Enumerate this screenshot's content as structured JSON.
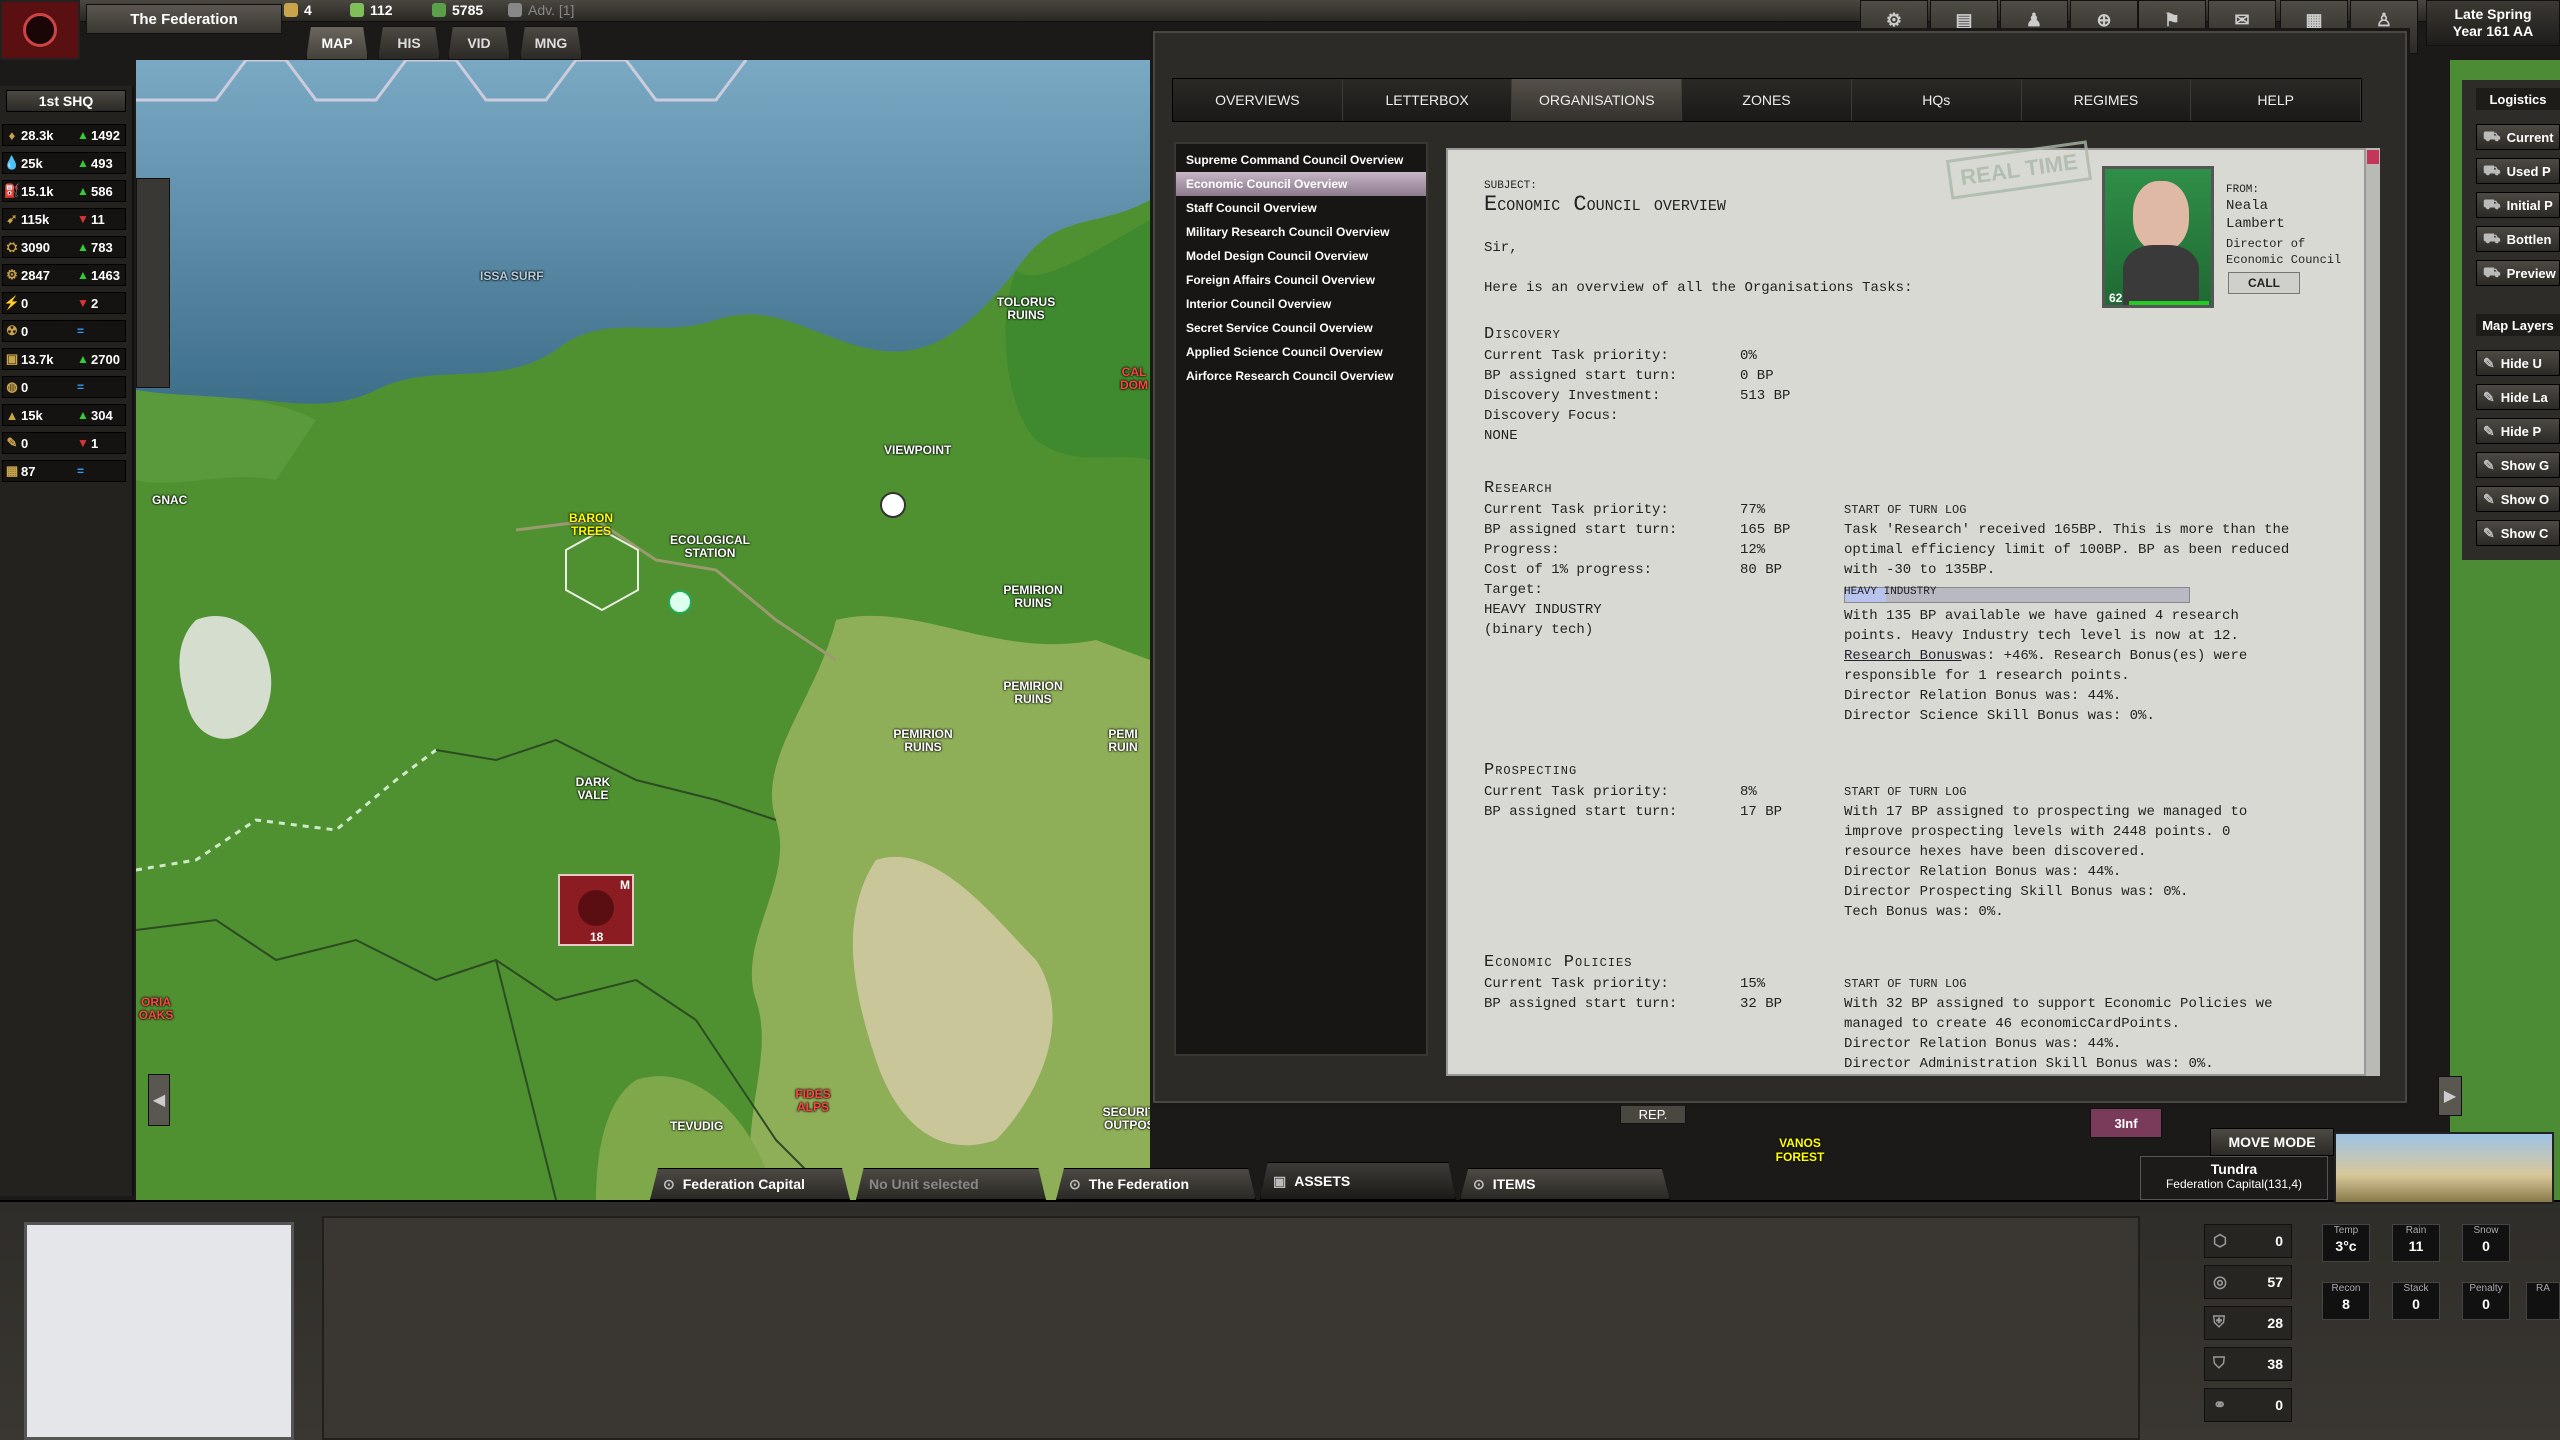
{
  "topbar": {
    "faction": "The Federation",
    "resources": [
      {
        "icon": "gear-icon",
        "value": "4",
        "color": "#c9a44a"
      },
      {
        "icon": "shield-icon",
        "value": "112",
        "color": "#7fbf5a"
      },
      {
        "icon": "money-icon",
        "value": "5785",
        "color": "#5aa04a"
      },
      {
        "icon": "advisor-icon",
        "value": "Adv. [1]",
        "color": "#888"
      }
    ],
    "nav": [
      "MAP",
      "HIS",
      "VID",
      "MNG"
    ],
    "icons": [
      {
        "name": "prefs-icon",
        "label": "PREFS",
        "glyph": "⚙"
      },
      {
        "name": "stats-icon",
        "label": "STATS",
        "glyph": "▤"
      },
      {
        "name": "oob-icon",
        "label": "OOB",
        "glyph": "♟"
      },
      {
        "name": "strategic-map-icon",
        "label": "S.MAP",
        "glyph": "⊕"
      },
      {
        "name": "strategy-icon",
        "label": "STRAT.",
        "glyph": "⚑"
      },
      {
        "name": "decisions-icon",
        "label": "DEC.",
        "glyph": "✉"
      },
      {
        "name": "report-icon",
        "label": "REP.",
        "glyph": "▦"
      },
      {
        "name": "mini-icon",
        "label": "MINI",
        "glyph": "♙"
      }
    ],
    "season": [
      "Late Spring",
      "Year 161 AA"
    ]
  },
  "left": {
    "hq": "1st SHQ",
    "rows": [
      {
        "icon": "supply-icon",
        "v1": "28.3k",
        "arrow": "▲",
        "arrowColor": "#3c3",
        "v2": "1492"
      },
      {
        "icon": "water-icon",
        "v1": "25k",
        "arrow": "▲",
        "arrowColor": "#3c3",
        "v2": "493"
      },
      {
        "icon": "fuel-icon",
        "v1": "15.1k",
        "arrow": "▲",
        "arrowColor": "#3c3",
        "v2": "586"
      },
      {
        "icon": "ammo-icon",
        "v1": "115k",
        "arrow": "▼",
        "arrowColor": "#d33",
        "v2": "11"
      },
      {
        "icon": "tank-icon",
        "v1": "3090",
        "arrow": "▲",
        "arrowColor": "#3c3",
        "v2": "783"
      },
      {
        "icon": "industry-icon",
        "v1": "2847",
        "arrow": "▲",
        "arrowColor": "#3c3",
        "v2": "1463"
      },
      {
        "icon": "energy-icon",
        "v1": "0",
        "arrow": "▼",
        "arrowColor": "#d33",
        "v2": "2"
      },
      {
        "icon": "radiation-icon",
        "v1": "0",
        "arrow": "=",
        "arrowColor": "#39f",
        "v2": ""
      },
      {
        "icon": "vehicle-icon",
        "v1": "13.7k",
        "arrow": "▲",
        "arrowColor": "#3c3",
        "v2": "2700"
      },
      {
        "icon": "food-icon",
        "v1": "0",
        "arrow": "=",
        "arrowColor": "#39f",
        "v2": ""
      },
      {
        "icon": "metal-icon",
        "v1": "15k",
        "arrow": "▲",
        "arrowColor": "#3c3",
        "v2": "304"
      },
      {
        "icon": "rare-icon",
        "v1": "0",
        "arrow": "▼",
        "arrowColor": "#d33",
        "v2": "1"
      },
      {
        "icon": "oil-icon",
        "v1": "87",
        "arrow": "=",
        "arrowColor": "#39f",
        "v2": ""
      }
    ]
  },
  "map": {
    "labels": [
      "ISSA SURF",
      "TOLORUS RUINS",
      "VIEWPOINT",
      "BARON TREES",
      "ECOLOGICAL STATION",
      "GNAC",
      "PEMIRION RUINS",
      "PEMIRION RUINS",
      "PEMIRION RUINS",
      "PEMI RUIN",
      "DARK VALE",
      "TEVUDIG",
      "FIDES ALPS",
      "SECURITY OUTPOST",
      "VANOS FOREST",
      "ORIA OAKS",
      "CAL DOM"
    ],
    "unit": {
      "mark": "M",
      "count": "18"
    },
    "rep": "REP.",
    "inf": "3Inf",
    "move_mode": "MOVE MODE",
    "terrain": "Tundra",
    "location": "Federation Capital(131,4)"
  },
  "window": {
    "tabs": [
      "OVERVIEWS",
      "LETTERBOX",
      "ORGANISATIONS",
      "ZONES",
      "HQs",
      "REGIMES",
      "HELP"
    ],
    "active_tab": 2,
    "orgs": [
      "Supreme Command Council Overview",
      "Economic Council Overview",
      "Staff Council Overview",
      "Military Research Council Overview",
      "Model Design Council Overview",
      "Foreign Affairs Council Overview",
      "Interior Council Overview",
      "Secret Service Council Overview",
      "Applied Science Council Overview",
      "Airforce Research Council Overview"
    ],
    "selected_org": 1
  },
  "letter": {
    "stamp": "REAL TIME",
    "subject_label": "SUBJECT:",
    "subject": "Economic Council overview",
    "from_label": "FROM:",
    "from_name": [
      "Neala",
      "Lambert"
    ],
    "from_role": [
      "Director of",
      "Economic Council"
    ],
    "call": "CALL",
    "portrait_level": "62",
    "salutation": "Sir,",
    "intro": "Here is an overview of all the Organisations Tasks:",
    "discovery": {
      "title": "Discovery",
      "lines": [
        [
          "Current Task priority:",
          "0%"
        ],
        [
          "BP assigned start turn:",
          "0 BP"
        ],
        [
          "Discovery Investment:",
          "513 BP"
        ],
        [
          "Discovery Focus:",
          ""
        ],
        [
          "NONE",
          ""
        ]
      ]
    },
    "research": {
      "title": "Research",
      "lines": [
        [
          "Current Task priority:",
          "77%"
        ],
        [
          "BP assigned start turn:",
          "165 BP"
        ],
        [
          "Progress:",
          "12%"
        ],
        [
          "Cost of 1% progress:",
          "80 BP"
        ],
        [
          "Target:",
          ""
        ],
        [
          "HEAVY INDUSTRY",
          ""
        ],
        [
          "(binary tech)",
          ""
        ]
      ],
      "log_title": "START OF TURN LOG",
      "log1": [
        "Task 'Research' received 165BP. This is more than the",
        "optimal efficiency limit of 100BP. BP as been reduced",
        "with -30 to 135BP."
      ],
      "bar_label": "HEAVY INDUSTRY",
      "bar_progress": 0.12,
      "log2": [
        "With 135 BP available we have gained 4 research",
        "points. Heavy Industry tech level is now at 12."
      ],
      "bonus_link": "Research Bonus",
      "bonus_rest": " was: +46%. Research Bonus(es) were",
      "log3": [
        "responsible for 1 research points.",
        "Director Relation Bonus was: 44%.",
        "Director Science Skill Bonus was: 0%."
      ]
    },
    "prospecting": {
      "title": "Prospecting",
      "lines": [
        [
          "Current Task priority:",
          "8%"
        ],
        [
          "BP assigned start turn:",
          "17 BP"
        ]
      ],
      "log_title": "START OF TURN LOG",
      "log": [
        "With 17 BP assigned to prospecting we managed to",
        "improve prospecting levels with 2448 points. 0",
        "resource hexes have been discovered.",
        "Director Relation Bonus was: 44%.",
        "Director Prospecting Skill Bonus was: 0%.",
        " Tech Bonus was: 0%."
      ]
    },
    "economic": {
      "title": "Economic Policies",
      "lines": [
        [
          "Current Task priority:",
          "15%"
        ],
        [
          "BP assigned start turn:",
          "32 BP"
        ]
      ],
      "log_title": "START OF TURN LOG",
      "log": [
        "With 32 BP assigned to support Economic Policies we",
        "managed to create 46 economicCardPoints.",
        "Director Relation Bonus was: 44%.",
        "Director Administration Skill Bonus was: 0%."
      ]
    }
  },
  "right": {
    "head1": "Logistics",
    "btns1": [
      "Current",
      "Used P",
      "Initial P",
      "Bottlen",
      "Preview"
    ],
    "head2": "Map Layers",
    "btns2": [
      "Hide U",
      "Hide La",
      "Hide P",
      "Show G",
      "Show O",
      "Show C"
    ]
  },
  "bottom": {
    "tabs": [
      "Federation Capital",
      "No Unit selected",
      "The Federation",
      "ASSETS",
      "ITEMS"
    ],
    "counts": [
      "0",
      "57",
      "28",
      "38",
      "0"
    ],
    "stats": [
      [
        "Temp",
        "3°c"
      ],
      [
        "Rain",
        "11"
      ],
      [
        "Snow",
        "0"
      ],
      [
        "Recon",
        "8"
      ],
      [
        "Stack",
        "0"
      ],
      [
        "Penalty",
        "0"
      ],
      [
        "RA",
        ""
      ]
    ]
  }
}
